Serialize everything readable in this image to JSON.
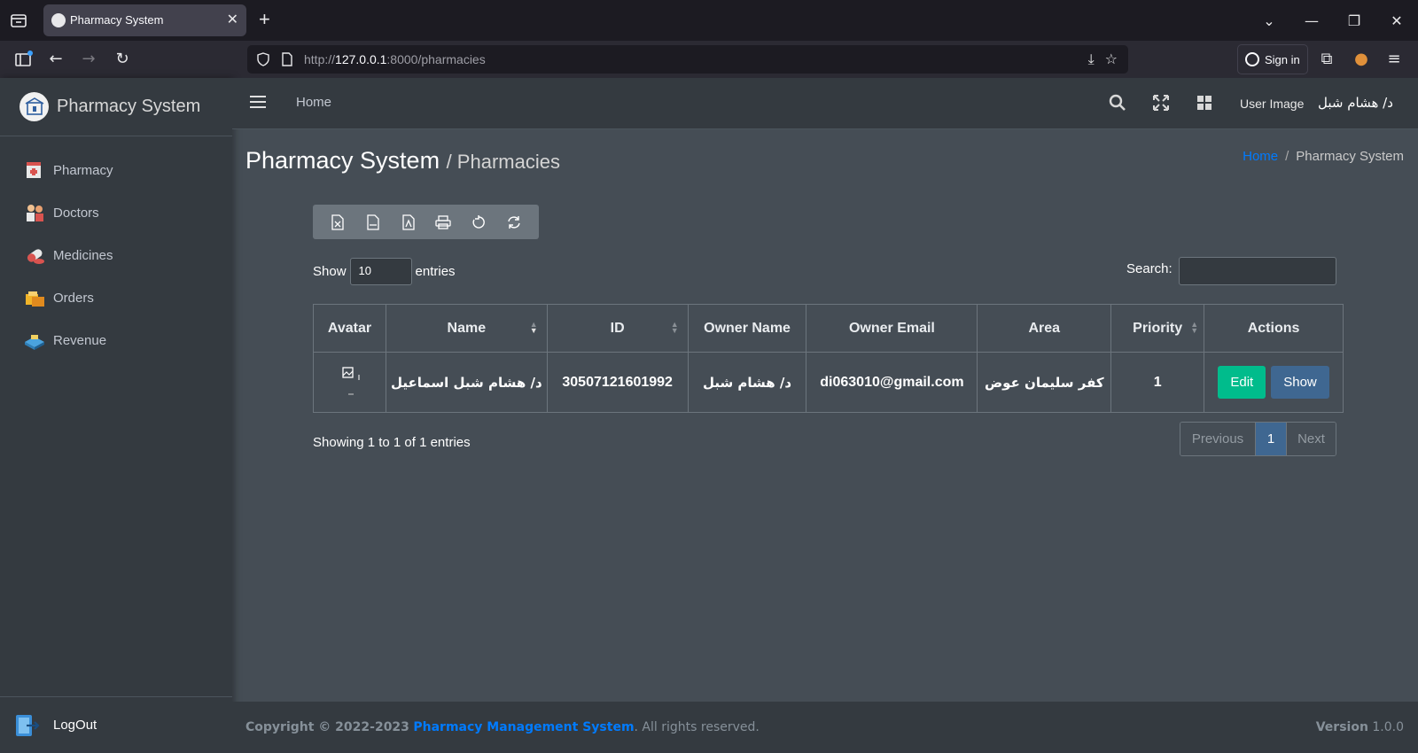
{
  "browser": {
    "tab_title": "Pharmacy System",
    "url_host": "127.0.0.1",
    "url_port_path": ":8000/pharmacies",
    "url_prefix": "http://",
    "signin_label": "Sign in"
  },
  "sidebar": {
    "brand": "Pharmacy System",
    "items": [
      {
        "label": "Pharmacy",
        "icon": "pharmacy-icon"
      },
      {
        "label": "Doctors",
        "icon": "doctors-icon"
      },
      {
        "label": "Medicines",
        "icon": "medicines-icon"
      },
      {
        "label": "Orders",
        "icon": "orders-icon"
      },
      {
        "label": "Revenue",
        "icon": "revenue-icon"
      }
    ],
    "logout": "LogOut"
  },
  "topnav": {
    "home": "Home",
    "user_image_alt": "User Image",
    "user_name": "د/ هشام شبل"
  },
  "header": {
    "title": "Pharmacy System",
    "subtitle": "/ Pharmacies",
    "breadcrumb_home": "Home",
    "breadcrumb_current": "Pharmacy System"
  },
  "datatable": {
    "show_label": "Show",
    "length_value": "10",
    "entries_label": "entries",
    "search_label": "Search:",
    "columns": [
      "Avatar",
      "Name",
      "ID",
      "Owner Name",
      "Owner Email",
      "Area",
      "Priority",
      "Actions"
    ],
    "rows": [
      {
        "name": "د/ هشام شبل اسماعيل",
        "id": "30507121601992",
        "owner_name": "د/ هشام شبل",
        "owner_email": "di063010@gmail.com",
        "area": "كفر سليمان عوض",
        "priority": "1",
        "edit": "Edit",
        "show": "Show"
      }
    ],
    "info": "Showing 1 to 1 of 1 entries",
    "prev": "Previous",
    "page": "1",
    "next": "Next"
  },
  "footer": {
    "copyright": "Copyright © 2022-2023",
    "link": "Pharmacy Management System",
    "rights": ". All rights reserved.",
    "version_label": "Version",
    "version": "1.0.0"
  }
}
